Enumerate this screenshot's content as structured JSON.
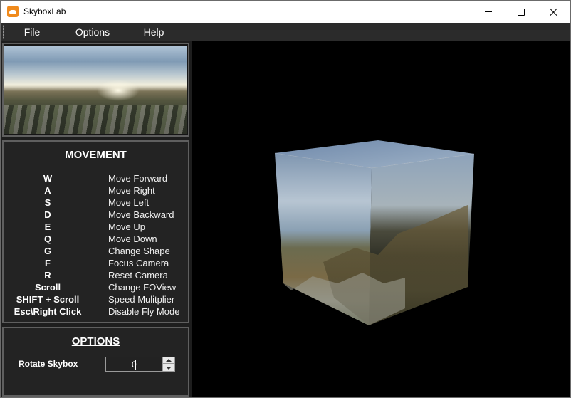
{
  "window": {
    "title": "SkyboxLab",
    "icon": "skyboxlab-app-icon",
    "controls": {
      "minimize": "minimize-icon",
      "maximize": "maximize-icon",
      "close": "close-icon"
    }
  },
  "menu": {
    "items": [
      "File",
      "Options",
      "Help"
    ]
  },
  "movement": {
    "heading": "MOVEMENT",
    "bindings": [
      {
        "key": "W",
        "action": "Move Forward"
      },
      {
        "key": "A",
        "action": "Move Right"
      },
      {
        "key": "S",
        "action": "Move Left"
      },
      {
        "key": "D",
        "action": "Move Backward"
      },
      {
        "key": "E",
        "action": "Move Up"
      },
      {
        "key": "Q",
        "action": "Move Down"
      },
      {
        "key": "G",
        "action": "Change Shape"
      },
      {
        "key": "F",
        "action": "Focus Camera"
      },
      {
        "key": "R",
        "action": "Reset Camera"
      },
      {
        "key": "Scroll",
        "action": "Change FOView"
      },
      {
        "key": "SHIFT + Scroll",
        "action": "Speed Mulitplier"
      },
      {
        "key": "Esc\\Right Click",
        "action": "Disable Fly Mode"
      }
    ]
  },
  "options": {
    "heading": "OPTIONS",
    "rotate_label": "Rotate Skybox",
    "rotate_value": "0"
  },
  "colors": {
    "menu_bg": "#2b2b2b",
    "panel_bg": "#232323",
    "panel_border": "#5f5f5f",
    "viewport_bg": "#000000"
  }
}
